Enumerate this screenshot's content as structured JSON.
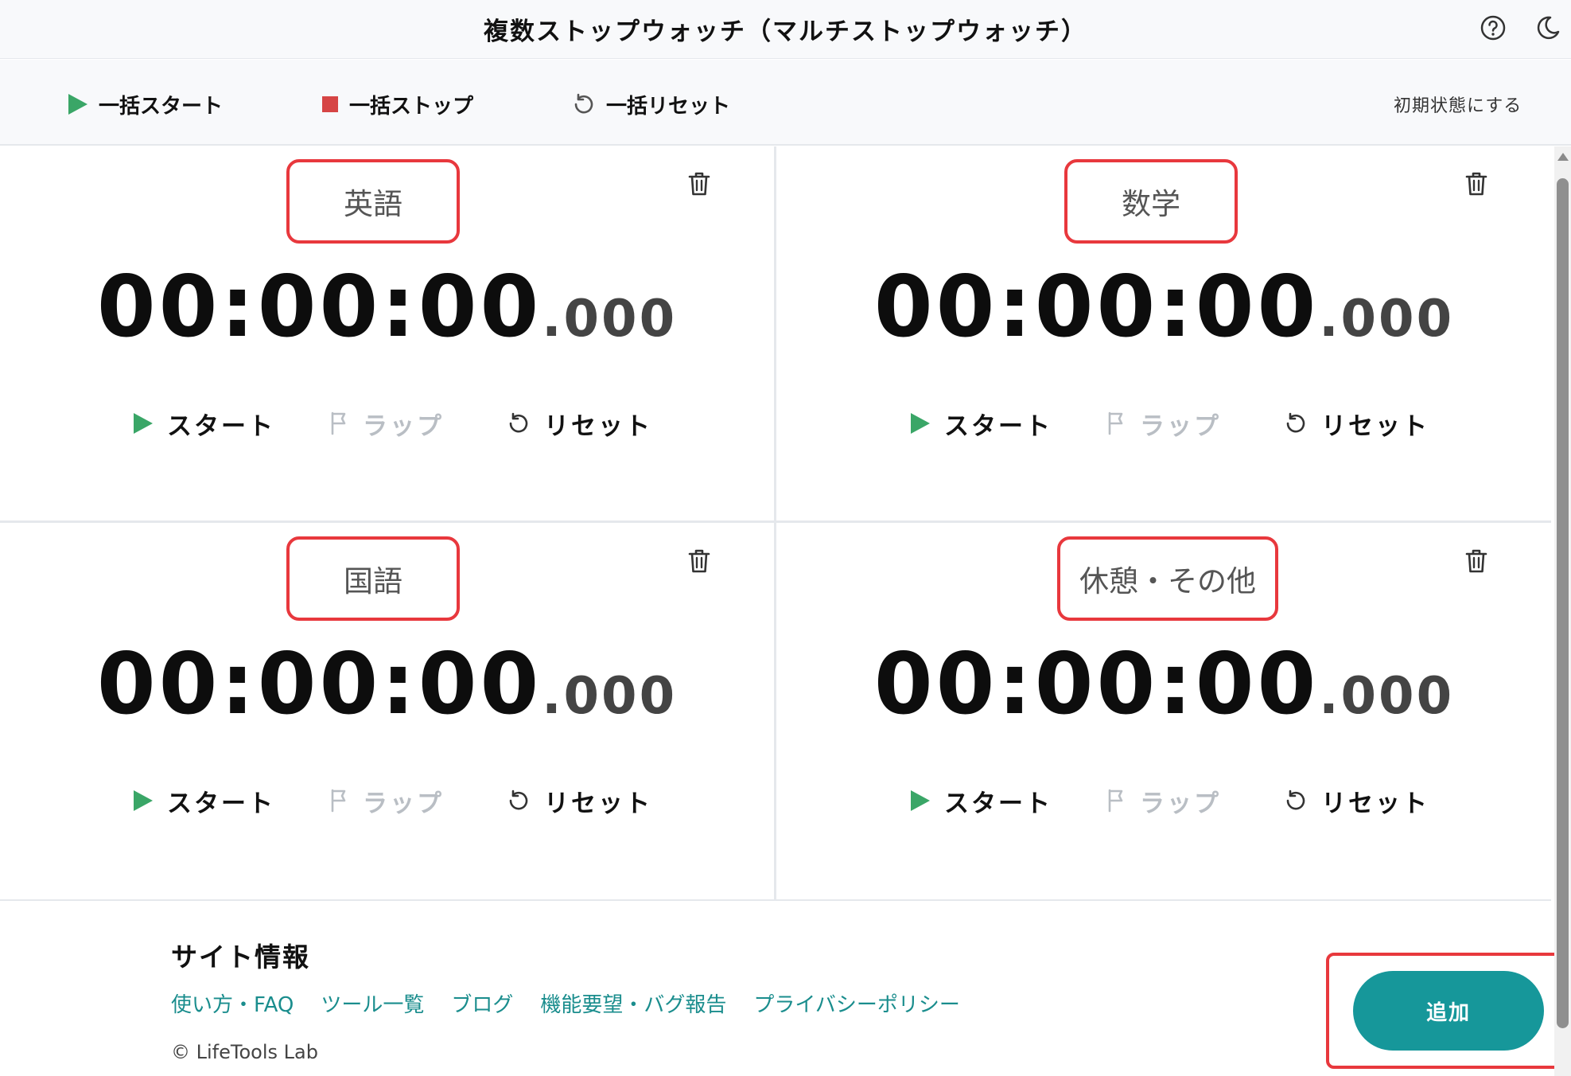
{
  "header": {
    "title": "複数ストップウォッチ（マルチストップウォッチ）",
    "help_icon": "help-circle-icon",
    "theme_icon": "moon-icon"
  },
  "toolbar": {
    "start_all": "一括スタート",
    "stop_all": "一括ストップ",
    "reset_all": "一括リセット",
    "initialize": "初期状態にする"
  },
  "timers": [
    {
      "label": "英語",
      "time": "00:00:00",
      "ms": ".000",
      "start": "スタート",
      "lap": "ラップ",
      "reset": "リセット"
    },
    {
      "label": "数学",
      "time": "00:00:00",
      "ms": ".000",
      "start": "スタート",
      "lap": "ラップ",
      "reset": "リセット"
    },
    {
      "label": "国語",
      "time": "00:00:00",
      "ms": ".000",
      "start": "スタート",
      "lap": "ラップ",
      "reset": "リセット"
    },
    {
      "label": "休憩・その他",
      "time": "00:00:00",
      "ms": ".000",
      "start": "スタート",
      "lap": "ラップ",
      "reset": "リセット"
    }
  ],
  "footer": {
    "title": "サイト情報",
    "links": [
      "使い方・FAQ",
      "ツール一覧",
      "ブログ",
      "機能要望・バグ報告",
      "プライバシーポリシー"
    ],
    "copyright": "© LifeTools Lab"
  },
  "add_button": "追加",
  "colors": {
    "accent": "#16979a",
    "start_green": "#3aa667",
    "stop_red": "#d64545",
    "highlight_red": "#e8383d",
    "link": "#1a8d8d",
    "disabled": "#b9bec4"
  }
}
